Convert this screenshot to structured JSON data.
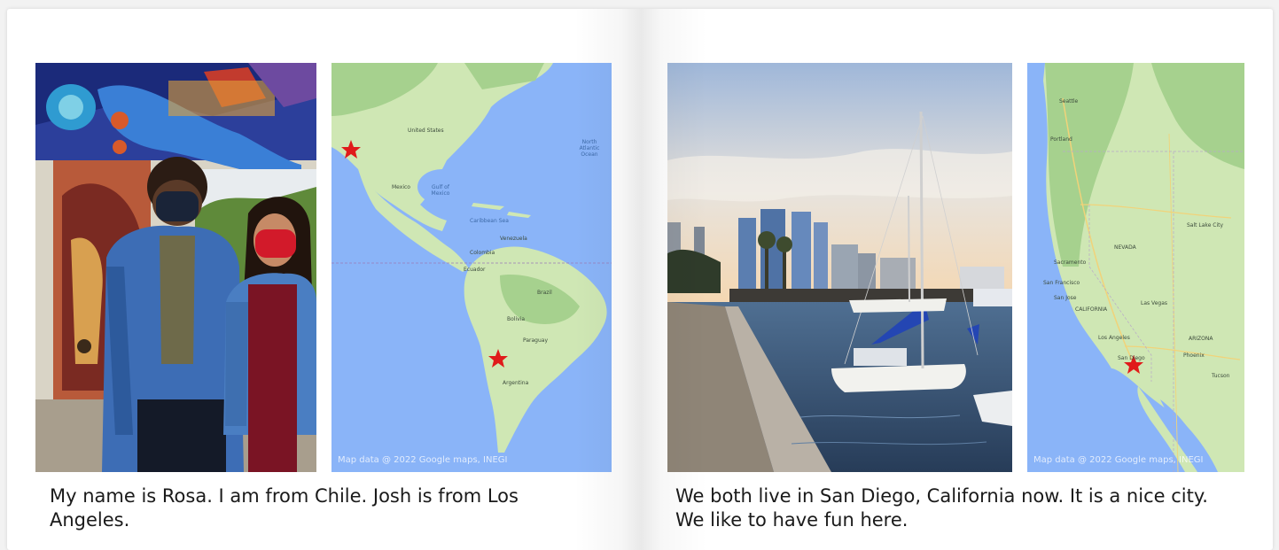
{
  "left_page": {
    "caption": "My name is Rosa. I am from Chile. Josh is from Los Angeles.",
    "map": {
      "credit": "Map data @ 2022 Google maps, INEGI",
      "labels": {
        "united_states": "United States",
        "mexico": "Mexico",
        "gulf_of_mexico": "Gulf of Mexico",
        "caribbean_sea": "Caribbean Sea",
        "north_atlantic_ocean": "North Atlantic Ocean",
        "venezuela": "Venezuela",
        "colombia": "Colombia",
        "ecuador": "Ecuador",
        "brazil": "Brazil",
        "bolivia": "Bolivia",
        "paraguay": "Paraguay",
        "argentina": "Argentina"
      }
    }
  },
  "right_page": {
    "caption": "We both live in San Diego, California now. It is a nice city. We like to have fun here.",
    "map": {
      "credit": "Map data @ 2022 Google maps, INEGI",
      "labels": {
        "seattle": "Seattle",
        "portland": "Portland",
        "nevada": "NEVADA",
        "salt_lake_city": "Salt Lake City",
        "sacramento": "Sacramento",
        "san_francisco": "San Francisco",
        "san_jose": "San Jose",
        "california": "CALIFORNIA",
        "las_vegas": "Las Vegas",
        "los_angeles": "Los Angeles",
        "san_diego": "San Diego",
        "phoenix": "Phoenix",
        "tucson": "Tucson",
        "arizona": "ARIZONA"
      }
    }
  },
  "colors": {
    "ocean": "#8ab4f8",
    "land": "#cfe7b4",
    "forest": "#a6d18e",
    "marker": "#e01b1b",
    "water": "#3c5f86"
  }
}
